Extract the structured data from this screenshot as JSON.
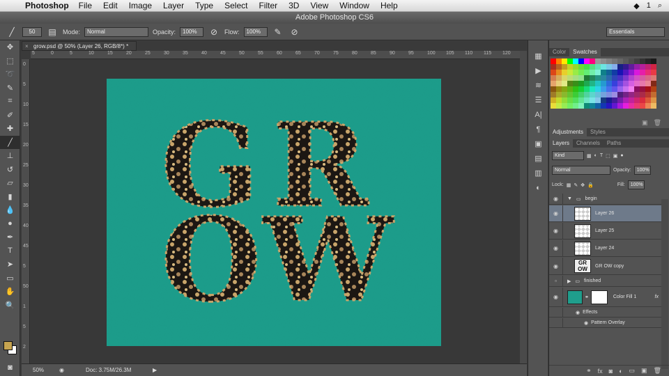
{
  "menubar": {
    "app": "Photoshop",
    "items": [
      "File",
      "Edit",
      "Image",
      "Layer",
      "Type",
      "Select",
      "Filter",
      "3D",
      "View",
      "Window",
      "Help"
    ],
    "status_number": "1"
  },
  "window_title": "Adobe Photoshop CS6",
  "options": {
    "brush_size": "50",
    "mode_label": "Mode:",
    "mode_value": "Normal",
    "opacity_label": "Opacity:",
    "opacity_value": "100%",
    "flow_label": "Flow:",
    "flow_value": "100%",
    "workspace": "Essentials"
  },
  "document": {
    "tab_title": "grow.psd @ 50% (Layer 26, RGB/8*) *",
    "canvas_color": "#1f9e8c",
    "letters": [
      "G",
      "R",
      "O",
      "W"
    ]
  },
  "rulers": {
    "h": [
      "5",
      "0",
      "5",
      "10",
      "15",
      "20",
      "25",
      "30",
      "35",
      "40",
      "45",
      "50",
      "55",
      "60",
      "65",
      "70",
      "75",
      "80",
      "85",
      "90",
      "95",
      "100",
      "105",
      "110",
      "115",
      "120"
    ],
    "v": [
      "0",
      "5",
      "10",
      "15",
      "20",
      "25",
      "30",
      "35",
      "40",
      "45",
      "5",
      "50",
      "1",
      "5",
      "2"
    ]
  },
  "status": {
    "zoom": "50%",
    "doc": "Doc: 3.75M/26.3M"
  },
  "panels": {
    "color_tabs": [
      "Color",
      "Swatches"
    ],
    "adj_tabs": [
      "Adjustments",
      "Styles"
    ],
    "layer_tabs": [
      "Layers",
      "Channels",
      "Paths"
    ],
    "kind": "Kind",
    "blend": "Normal",
    "opacity_label": "Opacity:",
    "opacity_value": "100%",
    "lock_label": "Lock:",
    "fill_label": "Fill:",
    "fill_value": "100%"
  },
  "layers": [
    {
      "name": "begin",
      "type": "group"
    },
    {
      "name": "Layer 26",
      "type": "layer",
      "selected": true
    },
    {
      "name": "Layer 25",
      "type": "layer"
    },
    {
      "name": "Layer 24",
      "type": "layer"
    },
    {
      "name": "GR OW copy",
      "type": "text"
    },
    {
      "name": "finished",
      "type": "group"
    },
    {
      "name": "Color Fill 1",
      "type": "fill",
      "fx": "fx"
    },
    {
      "name": "Effects",
      "type": "effect"
    },
    {
      "name": "Pattern Overlay",
      "type": "effect"
    }
  ]
}
